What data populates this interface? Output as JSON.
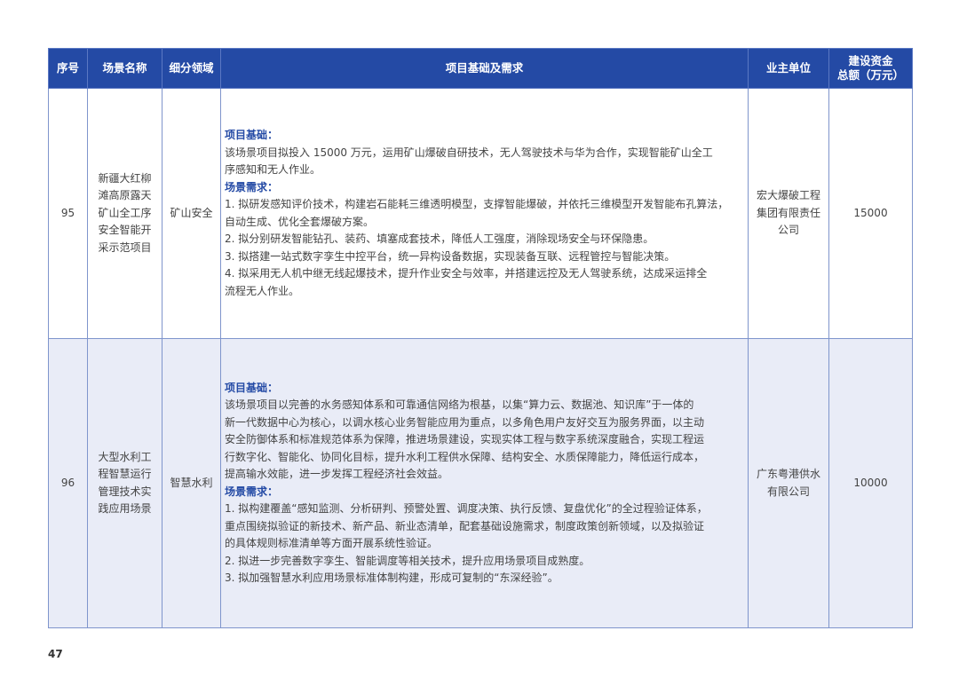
{
  "header": {
    "seq": "序号",
    "scene_name": "场景名称",
    "field": "细分领域",
    "basis": "项目基础及需求",
    "owner": "业主单位",
    "invest_line1": "建设资金",
    "invest_line2": "总额（万元）"
  },
  "rows": [
    {
      "seq": "95",
      "name_lines": [
        "新疆大红柳",
        "滩高原露天",
        "矿山全工序",
        "安全智能开",
        "采示范项目"
      ],
      "field": "矿山安全",
      "basis_title": "项目基础：",
      "basis_lines": [
        "该场景项目拟投入 15000 万元，运用矿山爆破自研技术，无人驾驶技术与华为合作，实现智能矿山全工",
        "序感知和无人作业。"
      ],
      "demand_title": "场景需求：",
      "demand_lines": [
        "1. 拟研发感知评价技术，构建岩石能耗三维透明模型，支撑智能爆破，并依托三维模型开发智能布孔算法，",
        "自动生成、优化全套爆破方案。",
        "2. 拟分别研发智能钻孔、装药、填塞成套技术，降低人工强度，消除现场安全与环保隐患。",
        "3. 拟搭建一站式数字孪生中控平台，统一异构设备数据，实现装备互联、远程管控与智能决策。",
        "4. 拟采用无人机中继无线起爆技术，提升作业安全与效率，并搭建远控及无人驾驶系统，达成采运排全",
        "流程无人作业。"
      ],
      "owner_lines": [
        "宏大爆破工程",
        "集团有限责任",
        "公司"
      ],
      "invest": "15000"
    },
    {
      "seq": "96",
      "name_lines": [
        "大型水利工",
        "程智慧运行",
        "管理技术实",
        "践应用场景"
      ],
      "field": "智慧水利",
      "basis_title": "项目基础：",
      "basis_lines": [
        "该场景项目以完善的水务感知体系和可靠通信网络为根基，以集“算力云、数据池、知识库”于一体的",
        "新一代数据中心为核心，以调水核心业务智能应用为重点，以多角色用户友好交互为服务界面，以主动",
        "安全防御体系和标准规范体系为保障，推进场景建设，实现实体工程与数字系统深度融合，实现工程运",
        "行数字化、智能化、协同化目标，提升水利工程供水保障、结构安全、水质保障能力，降低运行成本，",
        "提高输水效能，进一步发挥工程经济社会效益。"
      ],
      "demand_title": "场景需求：",
      "demand_lines": [
        "1. 拟构建覆盖“感知监测、分析研判、预警处置、调度决策、执行反馈、复盘优化”的全过程验证体系，",
        "重点围绕拟验证的新技术、新产品、新业态清单，配套基础设施需求，制度政策创新领域，以及拟验证",
        "的具体规则标准清单等方面开展系统性验证。",
        "2. 拟进一步完善数字孪生、智能调度等相关技术，提升应用场景项目成熟度。",
        "3. 拟加强智慧水利应用场景标准体制构建，形成可复制的“东深经验”。"
      ],
      "owner_lines": [
        "广东粤港供水",
        "有限公司"
      ],
      "invest": "10000"
    }
  ],
  "page_number": "47",
  "colors": {
    "header_bg": "#244aa5",
    "alt_row_bg": "#e9ecf7",
    "section_title": "#244aa5"
  }
}
